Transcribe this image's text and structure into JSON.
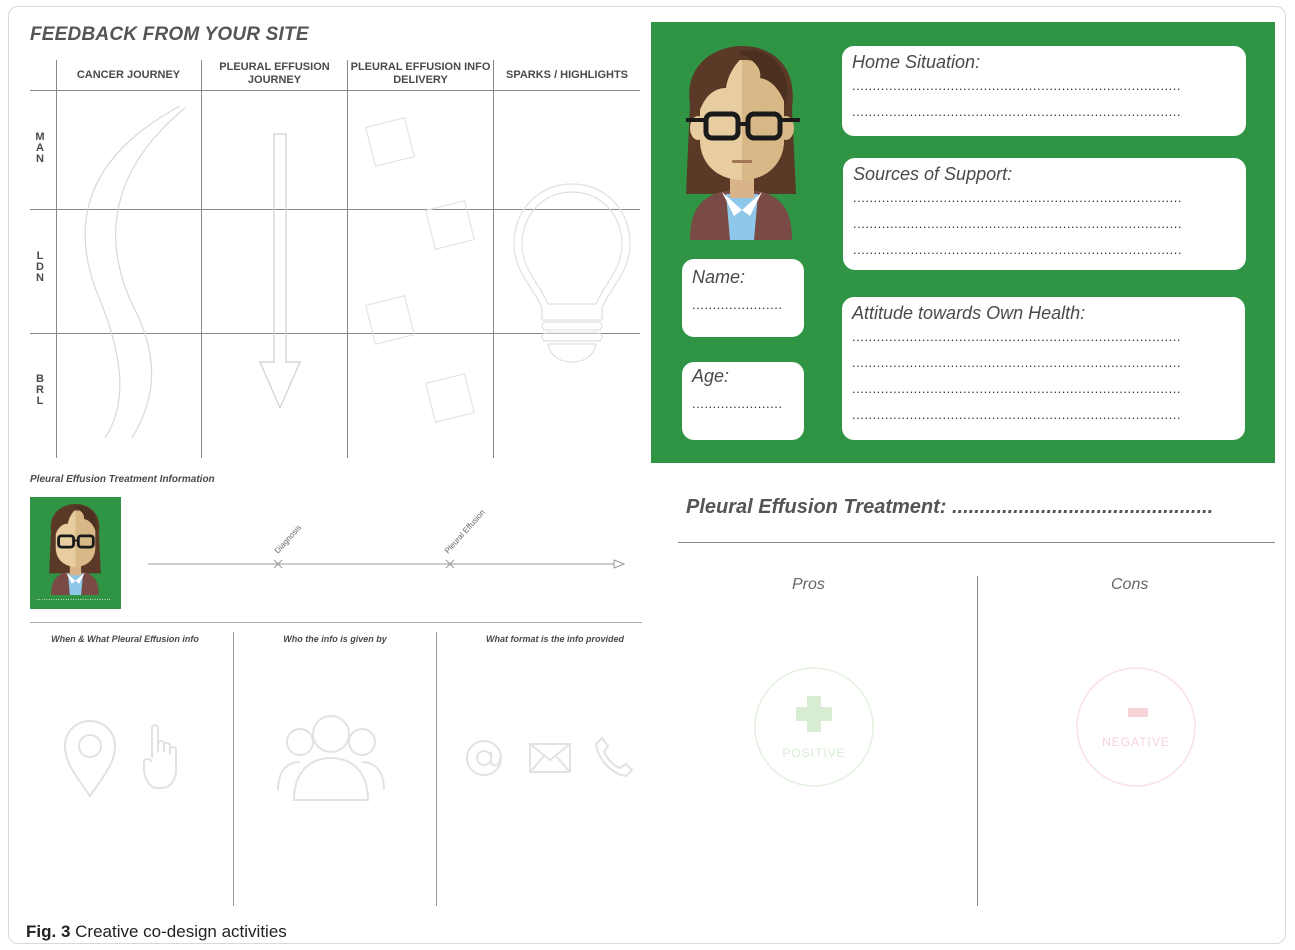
{
  "left_board": {
    "title": "FEEDBACK FROM YOUR SITE",
    "columns": [
      "CANCER JOURNEY",
      "PLEURAL EFFUSION JOURNEY",
      "PLEURAL EFFUSION INFO DELIVERY",
      "SPARKS / HIGHLIGHTS"
    ],
    "rows": [
      "MAN",
      "LDN",
      "BRL"
    ],
    "icons": [
      "road-icon",
      "arrow-down-icon",
      "sticky-note-icon",
      "lightbulb-icon"
    ]
  },
  "persona": {
    "fields": {
      "home_situation": "Home Situation:",
      "sources_of_support": "Sources of Support:",
      "attitude": "Attitude towards Own Health:",
      "name": "Name:",
      "age": "Age:"
    },
    "dots_long": "................................................................................",
    "dots_short": "......................",
    "panel_color": "#2f9444",
    "avatar_icon": "person-avatar-icon"
  },
  "treatment_info": {
    "title": "Pleural Effusion Treatment Information",
    "timeline_labels": [
      "Diagnosis",
      "Pleural Effusion"
    ],
    "avatar_dots": "...............................",
    "subheads": [
      "When & What Pleural Effusion info",
      "Who the info is given by",
      "What format is the info provided"
    ],
    "icons": [
      "location-pin-icon",
      "pointing-hand-icon",
      "people-group-icon",
      "at-sign-icon",
      "envelope-icon",
      "phone-icon"
    ]
  },
  "treatment": {
    "title": "Pleural Effusion Treatment:",
    "dots": "...............................................",
    "pros_label": "Pros",
    "cons_label": "Cons",
    "positive_label": "POSITIVE",
    "negative_label": "NEGATIVE",
    "positive_color": "#d7ecd3",
    "negative_color": "#f6d4d8"
  },
  "caption": {
    "fig": "Fig. 3",
    "text": "Creative co-design activities"
  }
}
